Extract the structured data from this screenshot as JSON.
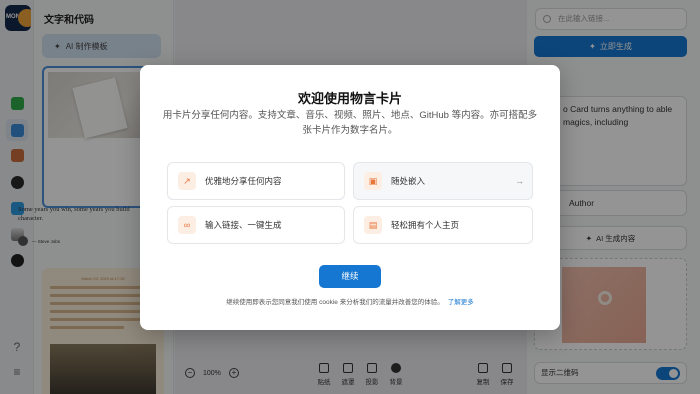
{
  "logo": {
    "text": "MON"
  },
  "rail": {
    "icons": [
      "link-icon",
      "quote-icon",
      "image-icon",
      "music-icon",
      "telegram-icon",
      "code-icon",
      "github-icon"
    ],
    "bottom": [
      "help-icon",
      "menu-icon"
    ]
  },
  "panel": {
    "title": "文字和代码",
    "ai_template_label": "AI 制作模板",
    "quote_text": "Some years you win, some years you build character.",
    "quote_author": "— Steve Jobs",
    "card2_date": "March 23, 2023 at 17:30"
  },
  "canvas": {
    "zoom_value": "100%",
    "tools": [
      "贴纸",
      "遮罩",
      "投影",
      "背景",
      "复制",
      "保存"
    ]
  },
  "right": {
    "link_placeholder": "在此输入链接...",
    "generate_label": "立即生成",
    "text_partial": "o Card turns anything to able magics, including",
    "author_label": "Author",
    "ai_content_label": "AI 生成内容",
    "qr_label": "显示二维码",
    "qr_enabled": true
  },
  "modal": {
    "title": "欢迎使用物言卡片",
    "subtitle": "用卡片分享任何内容。支持文章、音乐、视频、照片、地点、GitHub 等内容。亦可搭配多张卡片作为数字名片。",
    "features": [
      {
        "label": "优雅地分享任何内容",
        "icon": "trend-icon"
      },
      {
        "label": "随处嵌入",
        "icon": "image-icon"
      },
      {
        "label": "输入链接、一键生成",
        "icon": "link-icon"
      },
      {
        "label": "轻松拥有个人主页",
        "icon": "layout-icon"
      }
    ],
    "continue_label": "继续",
    "footer_text": "继续使用即表示您同意我们使用 cookie 来分析我们的流量并改善您的体验。",
    "learn_more": "了解更多"
  },
  "colors": {
    "accent": "#1677d2",
    "feature_icon": "#e8753a"
  }
}
